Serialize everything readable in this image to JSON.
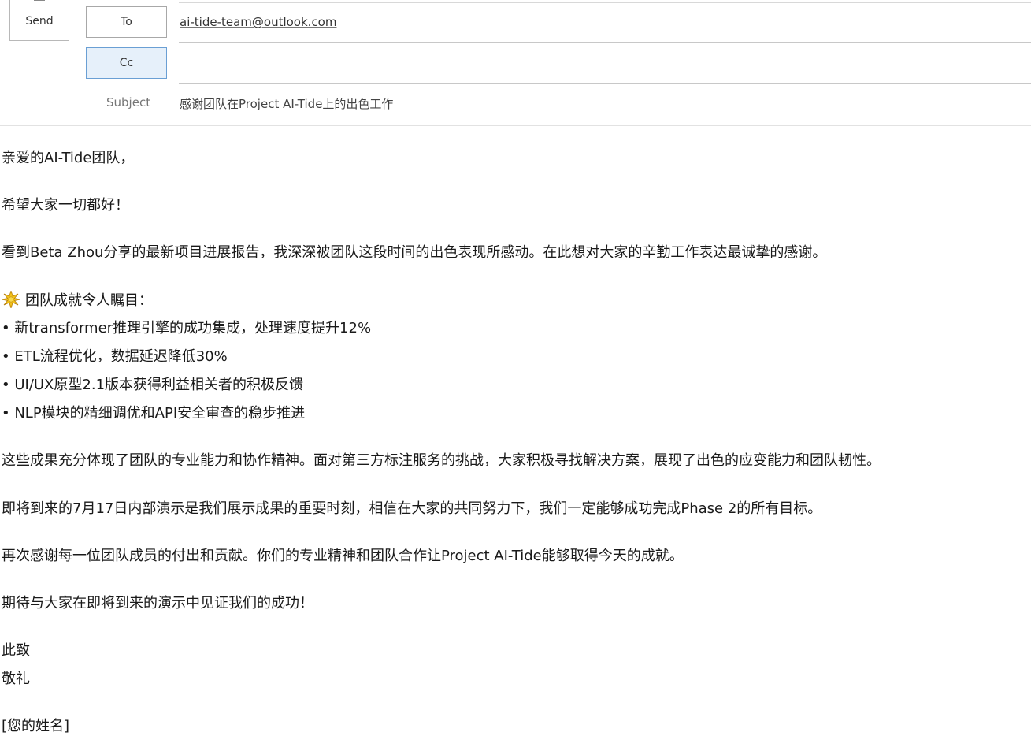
{
  "toolbar": {
    "send_label": "Send"
  },
  "recipients": {
    "to_button_label": "To",
    "to_value": "ai-tide-team@outlook.com",
    "cc_button_label": "Cc",
    "cc_value": ""
  },
  "subject": {
    "label": "Subject",
    "value": "感谢团队在Project AI-Tide上的出色工作"
  },
  "body": {
    "greeting": "亲爱的AI-Tide团队，",
    "wish": "希望大家一切都好！",
    "intro": "看到Beta Zhou分享的最新项目进展报告，我深深被团队这段时间的出色表现所感动。在此想对大家的辛勤工作表达最诚挚的感谢。",
    "achievements_title": "团队成就令人瞩目：",
    "achievements_icon": "sparkle-icon",
    "achievements": [
      "• 新transformer推理引擎的成功集成，处理速度提升12%",
      "• ETL流程优化，数据延迟降低30%",
      "• UI/UX原型2.1版本获得利益相关者的积极反馈",
      "• NLP模块的精细调优和API安全审查的稳步推进"
    ],
    "paragraph_1": "这些成果充分体现了团队的专业能力和协作精神。面对第三方标注服务的挑战，大家积极寻找解决方案，展现了出色的应变能力和团队韧性。",
    "paragraph_2": "即将到来的7月17日内部演示是我们展示成果的重要时刻，相信在大家的共同努力下，我们一定能够成功完成Phase 2的所有目标。",
    "paragraph_3": "再次感谢每一位团队成员的付出和贡献。你们的专业精神和团队合作让Project AI-Tide能够取得今天的成就。",
    "paragraph_4": "期待与大家在即将到来的演示中见证我们的成功！",
    "closing_1": "此致",
    "closing_2": "敬礼",
    "signature": "[您的姓名]"
  },
  "colors": {
    "cc_active_bg": "#e6f0fa",
    "cc_active_border": "#6a9fd4",
    "label_gray": "#767676"
  }
}
